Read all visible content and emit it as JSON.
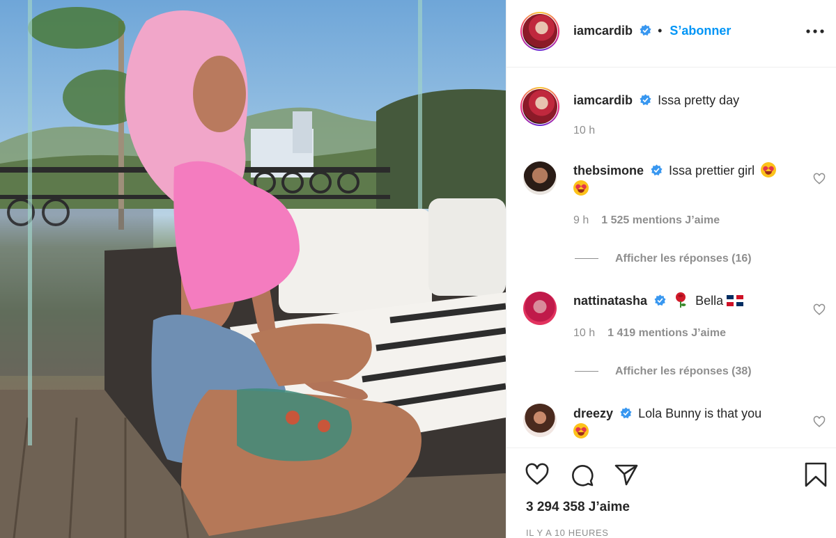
{
  "post": {
    "author": "iamcardib",
    "follow_label": "S’abonner",
    "separator": "•",
    "caption": "Issa pretty day",
    "caption_age": "10 h",
    "likes_label": "3 294 358 J’aime",
    "timestamp": "IL Y A 10 HEURES"
  },
  "comments": [
    {
      "user": "thebsimone",
      "text": "Issa prettier girl",
      "age": "9 h",
      "likes": "1 525 mentions J’aime",
      "replies": "Afficher les réponses (16)"
    },
    {
      "user": "nattinatasha",
      "text": "Bella",
      "age": "10 h",
      "likes": "1 419 mentions J’aime",
      "replies": "Afficher les réponses (38)"
    },
    {
      "user": "dreezy",
      "text": "Lola Bunny is that you"
    }
  ],
  "icons": [
    "more-options-icon",
    "verified-badge-icon",
    "heart-icon",
    "comment-icon",
    "share-icon",
    "bookmark-icon",
    "rose-emoji",
    "dominican-flag-emoji",
    "heart-eyes-emoji"
  ],
  "colors": {
    "accent": "#0095f6",
    "text": "#262626",
    "muted": "#8e8e8e",
    "verified": "#3897f0"
  }
}
